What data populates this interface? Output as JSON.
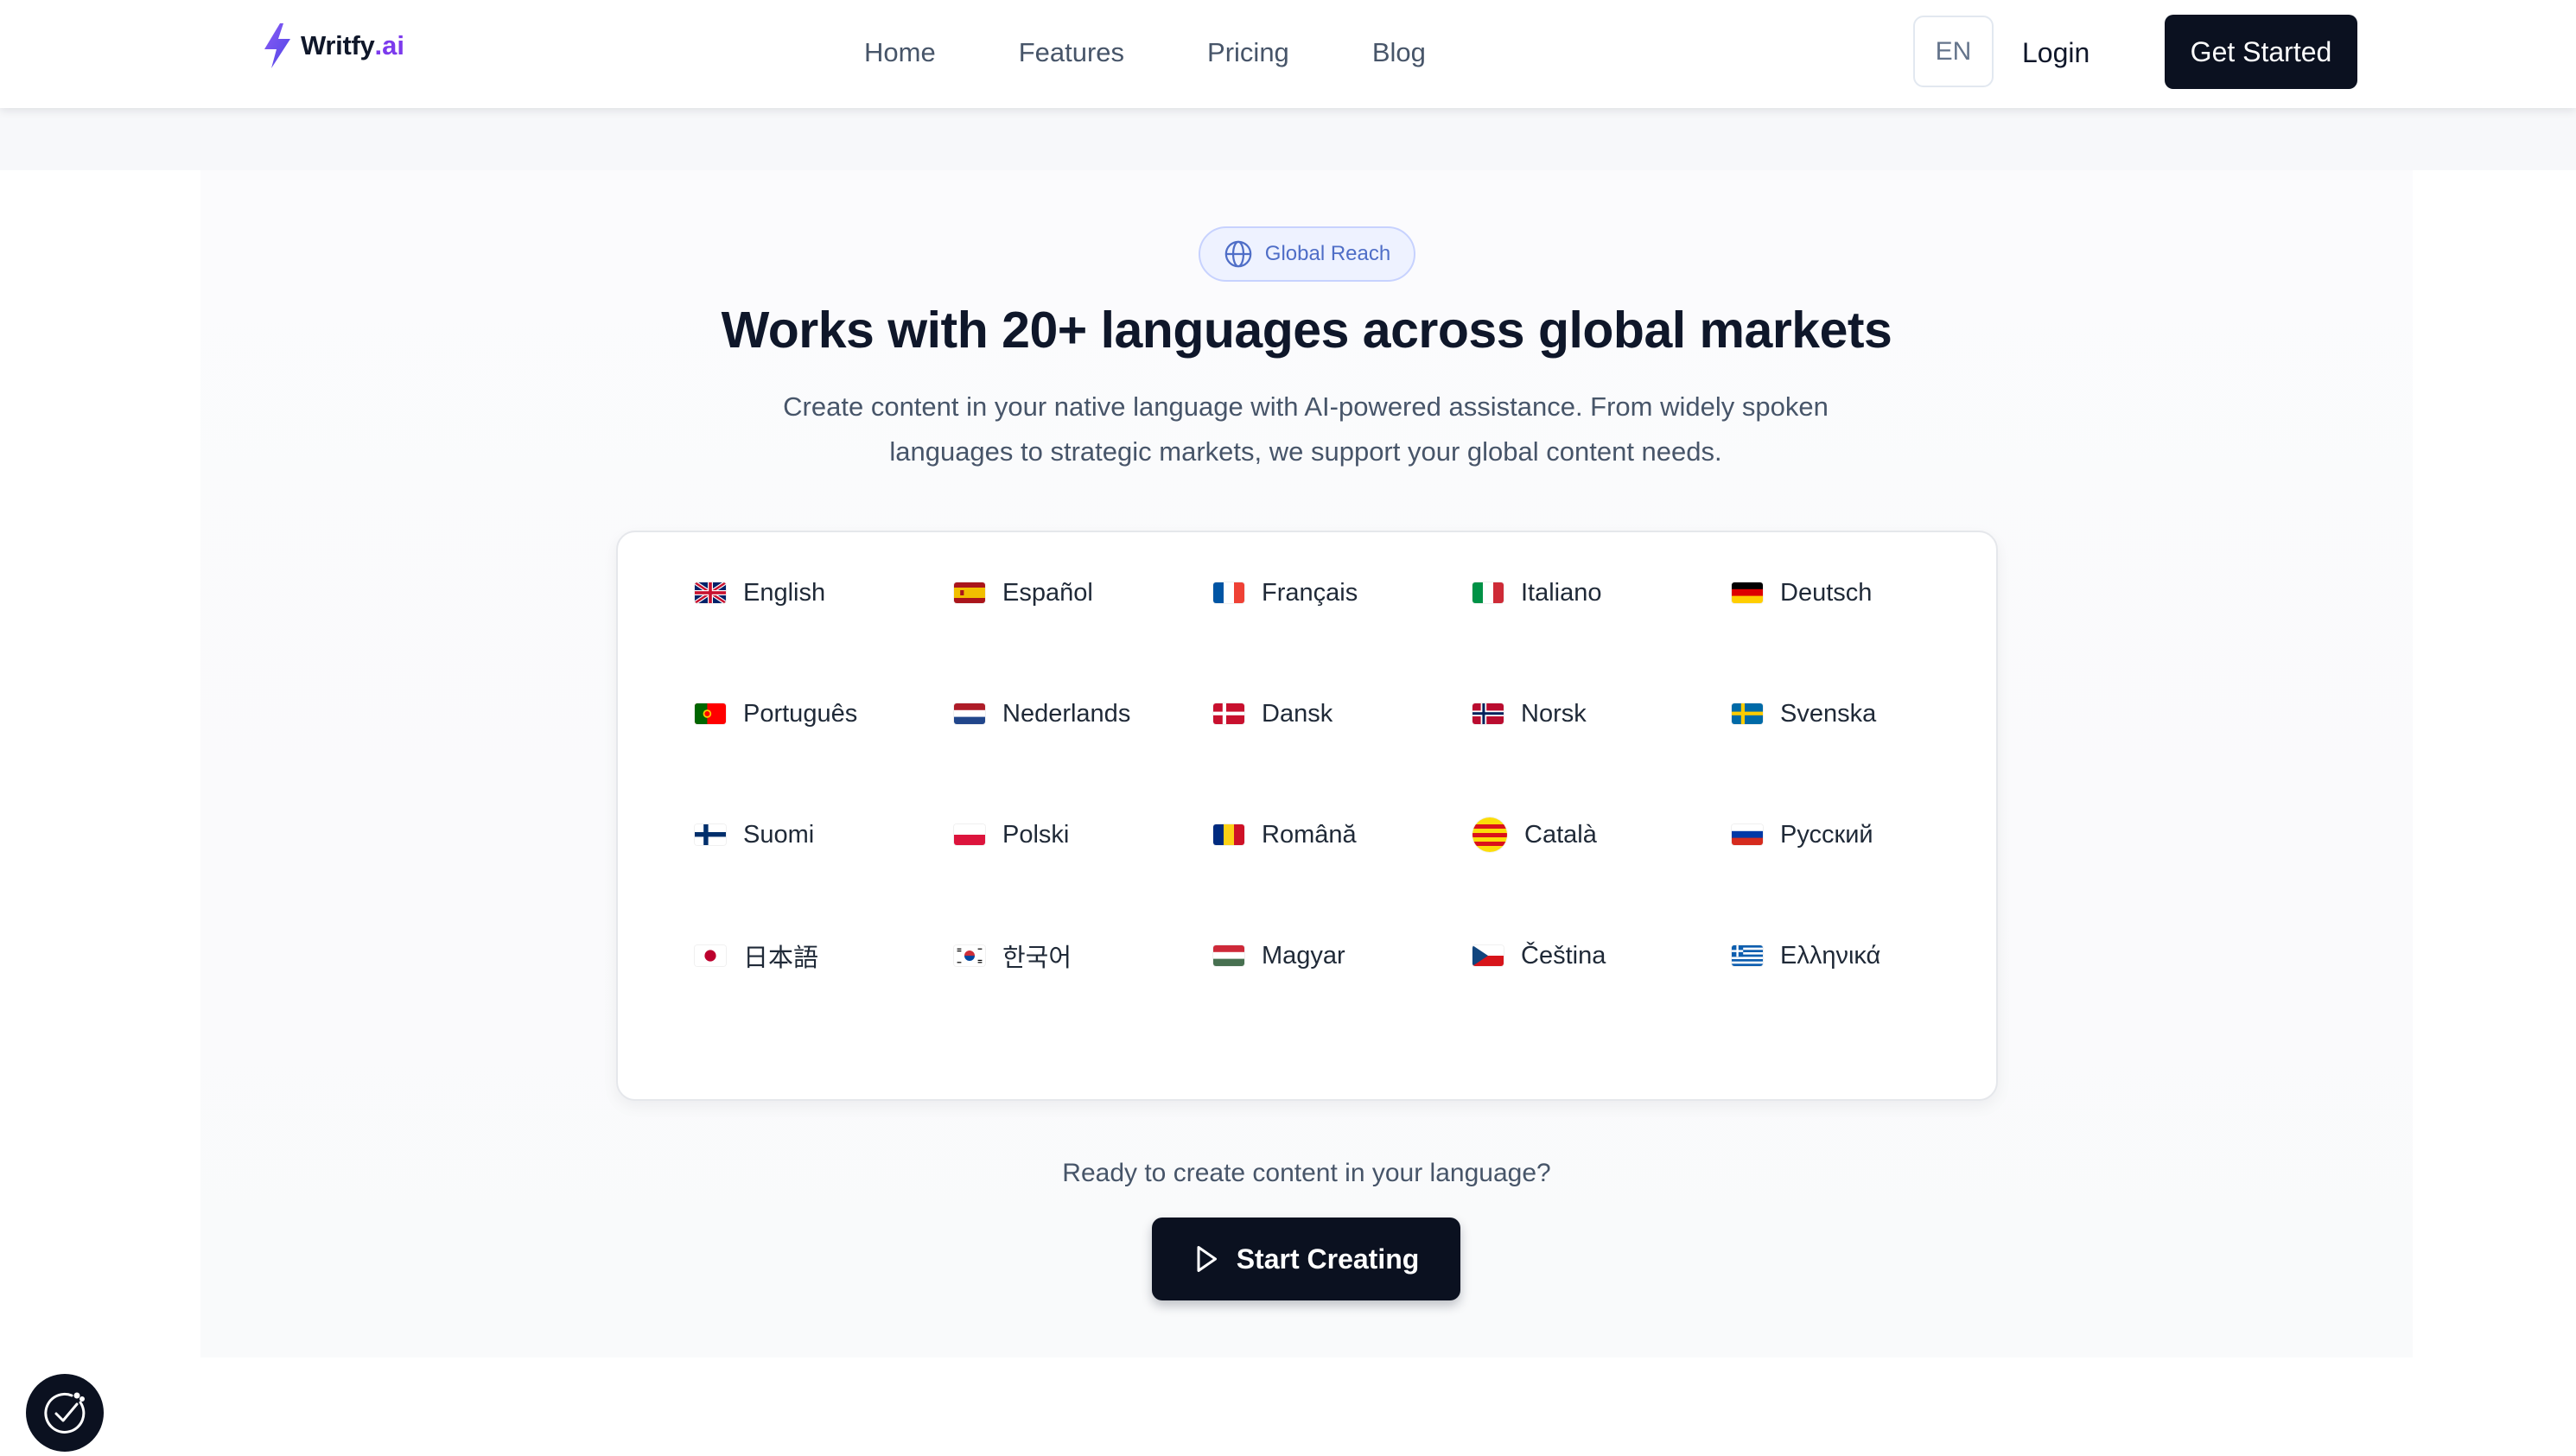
{
  "brand": {
    "name": "Writfy",
    "accent": ".ai",
    "accent_color": "#7c3aed"
  },
  "nav": {
    "items": [
      {
        "label": "Home"
      },
      {
        "label": "Features"
      },
      {
        "label": "Pricing"
      },
      {
        "label": "Blog"
      }
    ]
  },
  "header": {
    "language_code": "EN",
    "login_label": "Login",
    "cta_label": "Get Started"
  },
  "hero": {
    "badge_icon": "globe-icon",
    "badge_label": "Global Reach",
    "title": "Works with 20+ languages across global markets",
    "subtitle_line1": "Create content in your native language with AI-powered assistance. From widely spoken",
    "subtitle_line2": "languages to strategic markets, we support your global content needs."
  },
  "languages": [
    {
      "name": "English",
      "flag": "uk-flag-icon"
    },
    {
      "name": "Español",
      "flag": "spain-flag-icon"
    },
    {
      "name": "Français",
      "flag": "france-flag-icon"
    },
    {
      "name": "Italiano",
      "flag": "italy-flag-icon"
    },
    {
      "name": "Deutsch",
      "flag": "germany-flag-icon"
    },
    {
      "name": "Português",
      "flag": "portugal-flag-icon"
    },
    {
      "name": "Nederlands",
      "flag": "netherlands-flag-icon"
    },
    {
      "name": "Dansk",
      "flag": "denmark-flag-icon"
    },
    {
      "name": "Norsk",
      "flag": "norway-flag-icon"
    },
    {
      "name": "Svenska",
      "flag": "sweden-flag-icon"
    },
    {
      "name": "Suomi",
      "flag": "finland-flag-icon"
    },
    {
      "name": "Polski",
      "flag": "poland-flag-icon"
    },
    {
      "name": "Română",
      "flag": "romania-flag-icon"
    },
    {
      "name": "Català",
      "flag": "catalonia-flag-icon"
    },
    {
      "name": "Русский",
      "flag": "russia-flag-icon"
    },
    {
      "name": "日本語",
      "flag": "japan-flag-icon"
    },
    {
      "name": "한국어",
      "flag": "korea-flag-icon"
    },
    {
      "name": "Magyar",
      "flag": "hungary-flag-icon"
    },
    {
      "name": "Čeština",
      "flag": "czechia-flag-icon"
    },
    {
      "name": "Ελληνικά",
      "flag": "greece-flag-icon"
    }
  ],
  "cta": {
    "prompt": "Ready to create content in your language?",
    "button_icon": "play-icon",
    "button_label": "Start Creating"
  },
  "colors": {
    "primary_dark": "#0b1120",
    "text_muted": "#475569",
    "badge_bg": "#eef2ff",
    "badge_text": "#4f6ec7"
  }
}
